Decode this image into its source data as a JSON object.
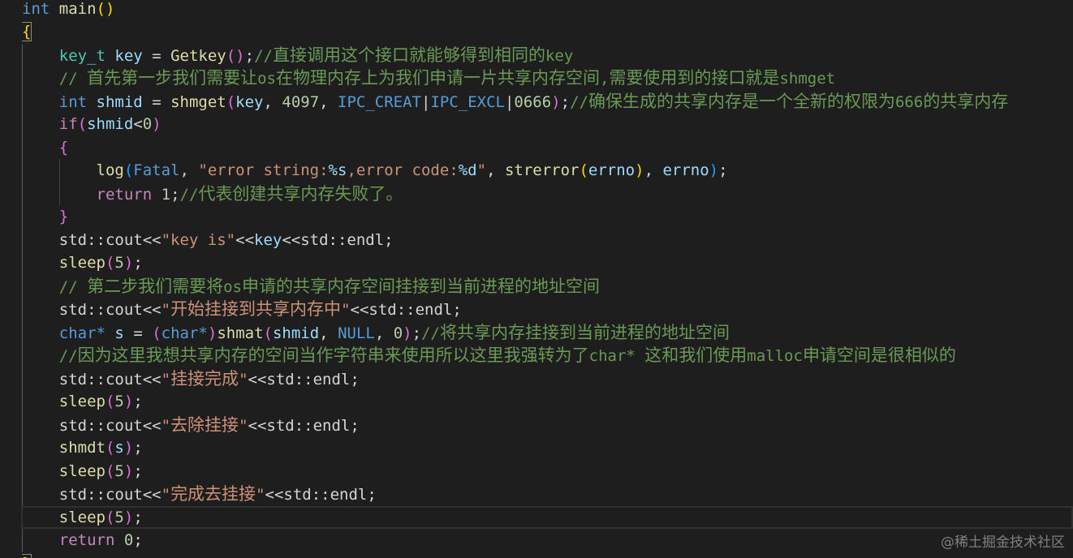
{
  "editor": {
    "background": "#1e1e1e",
    "foreground": "#d4d4d4",
    "lines": [
      [
        {
          "t": "int",
          "c": "#569cd6"
        },
        {
          "t": " "
        },
        {
          "t": "main",
          "c": "#dcdcaa"
        },
        {
          "t": "()",
          "c": "#ffd700"
        }
      ],
      [
        {
          "t": "{",
          "c": "#ffd700"
        }
      ],
      [
        {
          "t": "    "
        },
        {
          "t": "key_t",
          "c": "#4ec9b0"
        },
        {
          "t": " "
        },
        {
          "t": "key",
          "c": "#9cdcfe"
        },
        {
          "t": " = "
        },
        {
          "t": "Getkey",
          "c": "#dcdcaa"
        },
        {
          "t": "()",
          "c": "#da70d6"
        },
        {
          "t": ";"
        },
        {
          "t": "//",
          "c": "#6a9955"
        },
        {
          "t": "直接调用这个接口就能够得到相同的",
          "c": "#6a9955"
        },
        {
          "t": "key",
          "c": "#6a9955"
        }
      ],
      [
        {
          "t": "    "
        },
        {
          "t": "// ",
          "c": "#6a9955"
        },
        {
          "t": "首先第一步我们需要让",
          "c": "#6a9955"
        },
        {
          "t": "os",
          "c": "#6a9955"
        },
        {
          "t": "在物理内存上为我们申请一片共享内存空间",
          "c": "#6a9955"
        },
        {
          "t": ",",
          "c": "#6a9955"
        },
        {
          "t": "需要使用到的接口就是",
          "c": "#6a9955"
        },
        {
          "t": "shmget",
          "c": "#6a9955"
        }
      ],
      [
        {
          "t": "    "
        },
        {
          "t": "int",
          "c": "#569cd6"
        },
        {
          "t": " "
        },
        {
          "t": "shmid",
          "c": "#9cdcfe"
        },
        {
          "t": " = "
        },
        {
          "t": "shmget",
          "c": "#dcdcaa"
        },
        {
          "t": "(",
          "c": "#da70d6"
        },
        {
          "t": "key",
          "c": "#9cdcfe"
        },
        {
          "t": ", "
        },
        {
          "t": "4097",
          "c": "#b5cea8"
        },
        {
          "t": ", "
        },
        {
          "t": "IPC_CREAT",
          "c": "#569cd6"
        },
        {
          "t": "|"
        },
        {
          "t": "IPC_EXCL",
          "c": "#569cd6"
        },
        {
          "t": "|"
        },
        {
          "t": "0666",
          "c": "#b5cea8"
        },
        {
          "t": ")",
          "c": "#da70d6"
        },
        {
          "t": ";"
        },
        {
          "t": "//",
          "c": "#6a9955"
        },
        {
          "t": "确保生成的共享内存是一个全新的权限为",
          "c": "#6a9955"
        },
        {
          "t": "666",
          "c": "#6a9955"
        },
        {
          "t": "的共享内存",
          "c": "#6a9955"
        }
      ],
      [
        {
          "t": "    "
        },
        {
          "t": "if",
          "c": "#c586c0"
        },
        {
          "t": "(",
          "c": "#da70d6"
        },
        {
          "t": "shmid",
          "c": "#9cdcfe"
        },
        {
          "t": "<"
        },
        {
          "t": "0",
          "c": "#b5cea8"
        },
        {
          "t": ")",
          "c": "#da70d6"
        }
      ],
      [
        {
          "t": "    "
        },
        {
          "t": "{",
          "c": "#da70d6"
        }
      ],
      [
        {
          "t": "        "
        },
        {
          "t": "log",
          "c": "#dcdcaa"
        },
        {
          "t": "(",
          "c": "#179fff"
        },
        {
          "t": "Fatal",
          "c": "#569cd6"
        },
        {
          "t": ", "
        },
        {
          "t": "\"error string:",
          "c": "#ce9178"
        },
        {
          "t": "%s",
          "c": "#9cdcfe"
        },
        {
          "t": ",error code:",
          "c": "#ce9178"
        },
        {
          "t": "%d",
          "c": "#9cdcfe"
        },
        {
          "t": "\"",
          "c": "#ce9178"
        },
        {
          "t": ", "
        },
        {
          "t": "strerror",
          "c": "#dcdcaa"
        },
        {
          "t": "(",
          "c": "#ffd700"
        },
        {
          "t": "errno",
          "c": "#9cdcfe"
        },
        {
          "t": ")",
          "c": "#ffd700"
        },
        {
          "t": ", "
        },
        {
          "t": "errno",
          "c": "#9cdcfe"
        },
        {
          "t": ")",
          "c": "#179fff"
        },
        {
          "t": ";"
        }
      ],
      [
        {
          "t": "        "
        },
        {
          "t": "return",
          "c": "#c586c0"
        },
        {
          "t": " "
        },
        {
          "t": "1",
          "c": "#b5cea8"
        },
        {
          "t": ";"
        },
        {
          "t": "//",
          "c": "#6a9955"
        },
        {
          "t": "代表创建共享内存失败了。",
          "c": "#6a9955"
        }
      ],
      [
        {
          "t": "    "
        },
        {
          "t": "}",
          "c": "#da70d6"
        }
      ],
      [
        {
          "t": "    "
        },
        {
          "t": "std::cout<<"
        },
        {
          "t": "\"key is\"",
          "c": "#ce9178"
        },
        {
          "t": "<<"
        },
        {
          "t": "key",
          "c": "#9cdcfe"
        },
        {
          "t": "<<std::endl;"
        }
      ],
      [
        {
          "t": "    "
        },
        {
          "t": "sleep",
          "c": "#dcdcaa"
        },
        {
          "t": "(",
          "c": "#da70d6"
        },
        {
          "t": "5",
          "c": "#b5cea8"
        },
        {
          "t": ")",
          "c": "#da70d6"
        },
        {
          "t": ";"
        }
      ],
      [
        {
          "t": "    "
        },
        {
          "t": "// ",
          "c": "#6a9955"
        },
        {
          "t": "第二步我们需要将",
          "c": "#6a9955"
        },
        {
          "t": "os",
          "c": "#6a9955"
        },
        {
          "t": "申请的共享内存空间挂接到当前进程的地址空间",
          "c": "#6a9955"
        }
      ],
      [
        {
          "t": "    "
        },
        {
          "t": "std::cout<<"
        },
        {
          "t": "\"",
          "c": "#ce9178"
        },
        {
          "t": "开始挂接到共享内存中",
          "c": "#ce9178"
        },
        {
          "t": "\"",
          "c": "#ce9178"
        },
        {
          "t": "<<std::endl;"
        }
      ],
      [
        {
          "t": "    "
        },
        {
          "t": "char*",
          "c": "#569cd6"
        },
        {
          "t": " "
        },
        {
          "t": "s",
          "c": "#9cdcfe"
        },
        {
          "t": " = "
        },
        {
          "t": "(",
          "c": "#da70d6"
        },
        {
          "t": "char*",
          "c": "#569cd6"
        },
        {
          "t": ")",
          "c": "#da70d6"
        },
        {
          "t": "shmat",
          "c": "#dcdcaa"
        },
        {
          "t": "(",
          "c": "#da70d6"
        },
        {
          "t": "shmid",
          "c": "#9cdcfe"
        },
        {
          "t": ", "
        },
        {
          "t": "NULL",
          "c": "#569cd6"
        },
        {
          "t": ", "
        },
        {
          "t": "0",
          "c": "#b5cea8"
        },
        {
          "t": ")",
          "c": "#da70d6"
        },
        {
          "t": ";"
        },
        {
          "t": "//",
          "c": "#6a9955"
        },
        {
          "t": "将共享内存挂接到当前进程的地址空间",
          "c": "#6a9955"
        }
      ],
      [
        {
          "t": "    "
        },
        {
          "t": "//",
          "c": "#6a9955"
        },
        {
          "t": "因为这里我想共享内存的空间当作字符串来使用所以这里我强转为了",
          "c": "#6a9955"
        },
        {
          "t": "char* ",
          "c": "#6a9955"
        },
        {
          "t": "这和我们使用",
          "c": "#6a9955"
        },
        {
          "t": "malloc",
          "c": "#6a9955"
        },
        {
          "t": "申请空间是很相似的",
          "c": "#6a9955"
        }
      ],
      [
        {
          "t": "    "
        },
        {
          "t": "std::cout<<"
        },
        {
          "t": "\"",
          "c": "#ce9178"
        },
        {
          "t": "挂接完成",
          "c": "#ce9178"
        },
        {
          "t": "\"",
          "c": "#ce9178"
        },
        {
          "t": "<<std::endl;"
        }
      ],
      [
        {
          "t": "    "
        },
        {
          "t": "sleep",
          "c": "#dcdcaa"
        },
        {
          "t": "(",
          "c": "#da70d6"
        },
        {
          "t": "5",
          "c": "#b5cea8"
        },
        {
          "t": ")",
          "c": "#da70d6"
        },
        {
          "t": ";"
        }
      ],
      [
        {
          "t": "    "
        },
        {
          "t": "std::cout<<"
        },
        {
          "t": "\"",
          "c": "#ce9178"
        },
        {
          "t": "去除挂接",
          "c": "#ce9178"
        },
        {
          "t": "\"",
          "c": "#ce9178"
        },
        {
          "t": "<<std::endl;"
        }
      ],
      [
        {
          "t": "    "
        },
        {
          "t": "shmdt",
          "c": "#dcdcaa"
        },
        {
          "t": "(",
          "c": "#da70d6"
        },
        {
          "t": "s",
          "c": "#9cdcfe"
        },
        {
          "t": ")",
          "c": "#da70d6"
        },
        {
          "t": ";"
        }
      ],
      [
        {
          "t": "    "
        },
        {
          "t": "sleep",
          "c": "#dcdcaa"
        },
        {
          "t": "(",
          "c": "#da70d6"
        },
        {
          "t": "5",
          "c": "#b5cea8"
        },
        {
          "t": ")",
          "c": "#da70d6"
        },
        {
          "t": ";"
        }
      ],
      [
        {
          "t": "    "
        },
        {
          "t": "std::cout<<"
        },
        {
          "t": "\"",
          "c": "#ce9178"
        },
        {
          "t": "完成去挂接",
          "c": "#ce9178"
        },
        {
          "t": "\"",
          "c": "#ce9178"
        },
        {
          "t": "<<std::endl;"
        }
      ],
      [
        {
          "t": "    "
        },
        {
          "t": "sleep",
          "c": "#dcdcaa"
        },
        {
          "t": "(",
          "c": "#da70d6"
        },
        {
          "t": "5",
          "c": "#b5cea8"
        },
        {
          "t": ")",
          "c": "#da70d6"
        },
        {
          "t": ";"
        }
      ],
      [
        {
          "t": "    "
        },
        {
          "t": "return",
          "c": "#c586c0"
        },
        {
          "t": " "
        },
        {
          "t": "0",
          "c": "#b5cea8"
        },
        {
          "t": ";"
        }
      ],
      [
        {
          "t": "}",
          "c": "#ffd700"
        }
      ]
    ]
  },
  "watermark": "@稀土掘金技术社区"
}
